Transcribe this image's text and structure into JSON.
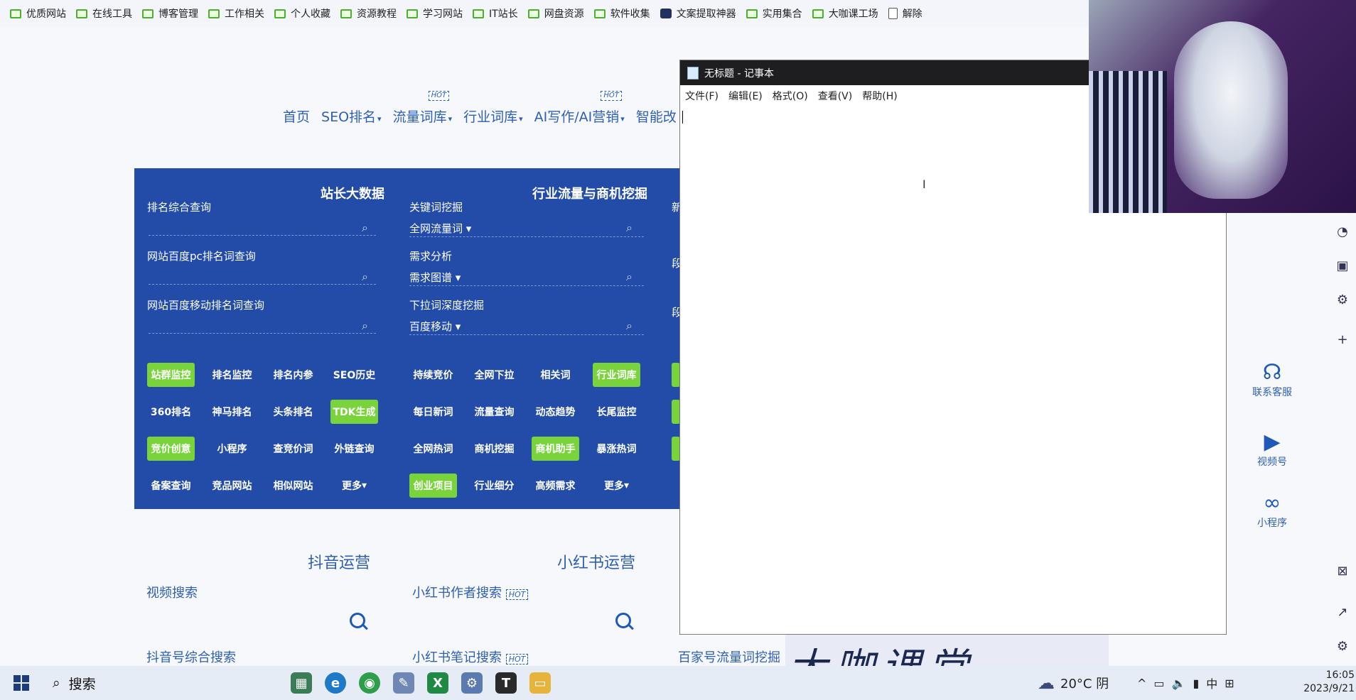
{
  "bookmarks": [
    {
      "label": "优质网站",
      "icon": "folder-icon"
    },
    {
      "label": "在线工具",
      "icon": "folder-icon"
    },
    {
      "label": "博客管理",
      "icon": "folder-icon"
    },
    {
      "label": "工作相关",
      "icon": "folder-icon"
    },
    {
      "label": "个人收藏",
      "icon": "folder-icon"
    },
    {
      "label": "资源教程",
      "icon": "folder-icon"
    },
    {
      "label": "学习网站",
      "icon": "folder-icon"
    },
    {
      "label": "IT站长",
      "icon": "folder-icon"
    },
    {
      "label": "网盘资源",
      "icon": "folder-icon"
    },
    {
      "label": "软件收集",
      "icon": "folder-icon"
    },
    {
      "label": "文案提取神器",
      "icon": "app-icon"
    },
    {
      "label": "实用集合",
      "icon": "folder-icon"
    },
    {
      "label": "大咖课工场",
      "icon": "folder-icon"
    },
    {
      "label": "解除",
      "icon": "document-icon"
    }
  ],
  "site_nav": {
    "home": "首页",
    "seo": "SEO排名",
    "traffic": "流量词库",
    "industry": "行业词库",
    "ai": "AI写作/AI营销",
    "smart": "智能改",
    "hot": "HOT"
  },
  "panel": {
    "title_left": "站长大数据",
    "title_mid": "行业流量与商机挖掘",
    "title_right_partial": "新",
    "left_fields": [
      {
        "label": "排名综合查询"
      },
      {
        "label": "网站百度pc排名词查询"
      },
      {
        "label": "网站百度移动排名词查询"
      }
    ],
    "mid_fields": [
      {
        "label": "关键词挖掘",
        "select": "全网流量词"
      },
      {
        "label": "需求分析",
        "select": "需求图谱"
      },
      {
        "label": "下拉词深度挖掘",
        "select": "百度移动"
      }
    ],
    "right_partial": [
      "段",
      "段"
    ],
    "left_buttons": [
      [
        "站群监控",
        "排名监控",
        "排名内参",
        "SEO历史"
      ],
      [
        "360排名",
        "神马排名",
        "头条排名",
        "TDK生成"
      ],
      [
        "竞价创意",
        "小程序",
        "查竞价词",
        "外链查询"
      ],
      [
        "备案查询",
        "竞品网站",
        "相似网站",
        "更多"
      ]
    ],
    "mid_buttons": [
      [
        "持续竞价",
        "全网下拉",
        "相关词",
        "行业词库"
      ],
      [
        "每日新词",
        "流量查询",
        "动态趋势",
        "长尾监控"
      ],
      [
        "全网热词",
        "商机挖掘",
        "商机助手",
        "暴涨热词"
      ],
      [
        "创业项目",
        "行业细分",
        "高频需求",
        "更多"
      ]
    ]
  },
  "sections": {
    "douyin_title": "抖音运营",
    "xhs_title": "小红书运营",
    "video_search": "视频搜索",
    "douyin_search": "抖音号综合搜索",
    "xhs_author": "小红书作者搜索",
    "xhs_notes": "小红书笔记搜索",
    "baijia": "百家号流量词挖掘",
    "hot": "HOT"
  },
  "notepad": {
    "title": "无标题 - 记事本",
    "menu": [
      "文件(F)",
      "编辑(E)",
      "格式(O)",
      "查看(V)",
      "帮助(H)"
    ],
    "content": ""
  },
  "right_panel": {
    "contact": "联系客服",
    "video": "视频号",
    "miniapp": "小程序"
  },
  "watermark": "大咖课堂",
  "taskbar": {
    "search": "搜索",
    "weather": "20°C 阴",
    "ime": "中",
    "time": "16:05",
    "date": "2023/9/21"
  }
}
